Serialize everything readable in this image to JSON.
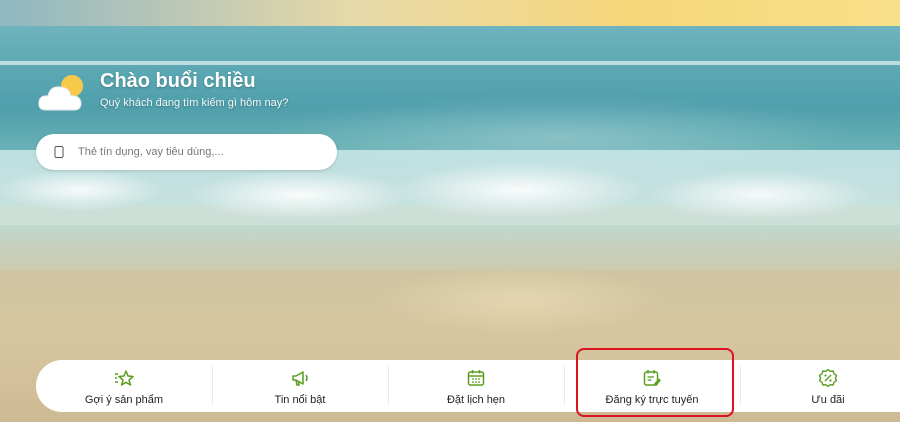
{
  "greeting": {
    "title": "Chào buổi chiều",
    "subtitle": "Quý khách đang tìm kiếm gì hôm nay?",
    "icon": "sun-cloud-icon"
  },
  "search": {
    "placeholder": "Thẻ tín dụng, vay tiêu dùng,...",
    "value": ""
  },
  "nav": {
    "items": [
      {
        "label": "Gợi ý sản phẩm",
        "icon": "star-sparkle-icon"
      },
      {
        "label": "Tin nổi bật",
        "icon": "megaphone-icon"
      },
      {
        "label": "Đặt lịch hẹn",
        "icon": "calendar-icon"
      },
      {
        "label": "Đăng ký trực tuyến",
        "icon": "calendar-edit-icon"
      },
      {
        "label": "Ưu đãi",
        "icon": "discount-badge-icon"
      }
    ]
  },
  "colors": {
    "accent_green": "#5a9e1e",
    "highlight_red": "#d9141e"
  }
}
